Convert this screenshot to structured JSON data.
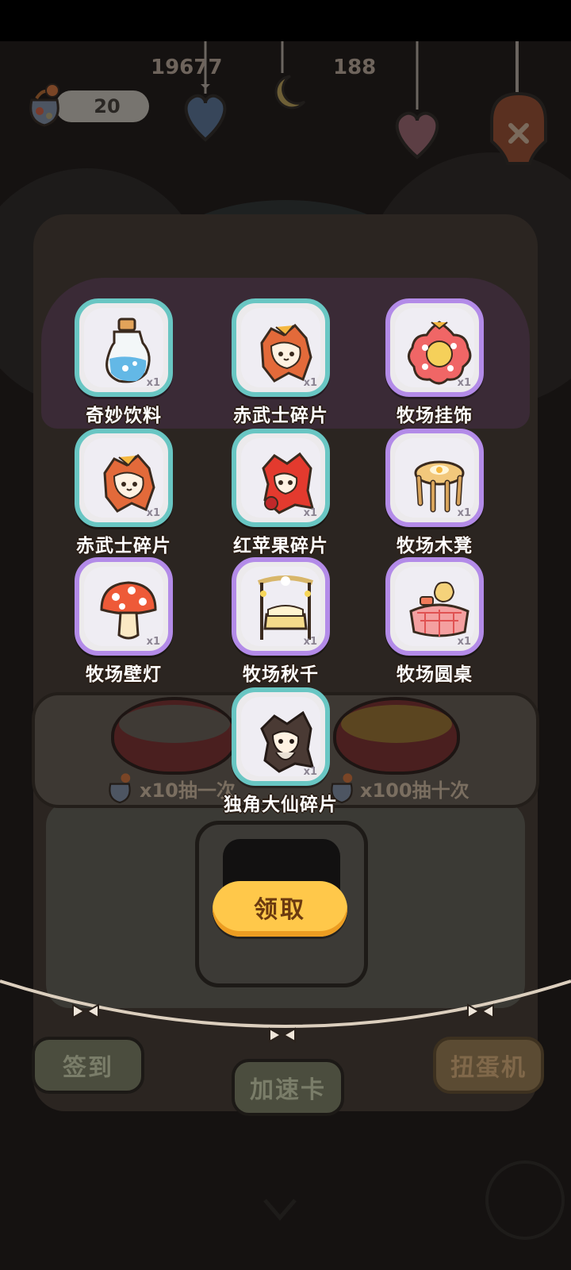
{
  "colors": {
    "overlay": "#000000",
    "card_border_blue": "#69c6c3",
    "card_border_purple": "#b38be8",
    "claim_button": "#ffc84a",
    "claim_text": "#6b3a10",
    "item_label": "#ffffff"
  },
  "hud": {
    "token_count": "20",
    "top_number_1": "19677",
    "top_number_2": "188",
    "token_icon": "seed-bag-icon"
  },
  "rewards": [
    {
      "name": "奇妙饮料",
      "qty": "x1",
      "icon": "potion-bottle-icon",
      "rarity": "blue"
    },
    {
      "name": "赤武士碎片",
      "qty": "x1",
      "icon": "red-samurai-fragment-icon",
      "rarity": "blue"
    },
    {
      "name": "牧场挂饰",
      "qty": "x1",
      "icon": "flower-ornament-icon",
      "rarity": "purple"
    },
    {
      "name": "赤武士碎片",
      "qty": "x1",
      "icon": "red-samurai-fragment-icon",
      "rarity": "blue"
    },
    {
      "name": "红苹果碎片",
      "qty": "x1",
      "icon": "red-apple-fragment-icon",
      "rarity": "blue"
    },
    {
      "name": "牧场木凳",
      "qty": "x1",
      "icon": "wooden-stool-icon",
      "rarity": "purple"
    },
    {
      "name": "牧场壁灯",
      "qty": "x1",
      "icon": "mushroom-lamp-icon",
      "rarity": "purple"
    },
    {
      "name": "牧场秋千",
      "qty": "x1",
      "icon": "swing-bed-icon",
      "rarity": "purple"
    },
    {
      "name": "牧场圆桌",
      "qty": "x1",
      "icon": "round-table-icon",
      "rarity": "purple"
    },
    {
      "name": "独角大仙碎片",
      "qty": "x1",
      "icon": "unicorn-sage-fragment-icon",
      "rarity": "blue"
    }
  ],
  "claim_button": {
    "label": "领取"
  },
  "draw_options": [
    {
      "label": "x10抽一次",
      "icon": "seed-bag-icon"
    },
    {
      "label": "x100抽十次",
      "icon": "seed-bag-icon"
    }
  ],
  "bottom_nav": {
    "checkin": "签到",
    "speedup": "加速卡",
    "gacha": "扭蛋机"
  }
}
